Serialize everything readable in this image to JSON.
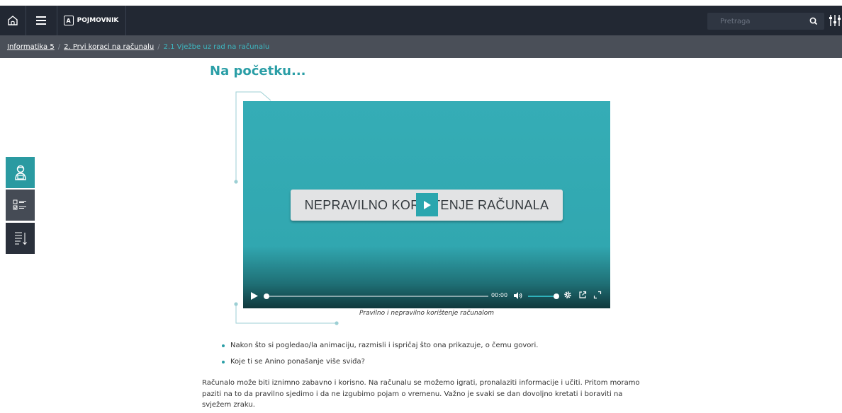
{
  "colors": {
    "topbar": "#222833",
    "breadcrumb_bar": "#4a4f58",
    "accent_teal": "#2a9ea6",
    "video_bg": "#31a7b0"
  },
  "header": {
    "home_icon": "home-icon",
    "menu_icon": "hamburger-menu-icon",
    "pojmovnik_badge": "A",
    "pojmovnik_label": "POJMOVNIK",
    "search_placeholder": "Pretraga",
    "search_icon": "search-icon",
    "settings_icon": "sliders-settings-icon"
  },
  "breadcrumb": {
    "items": [
      "Informatika 5",
      "2. Prvi koraci na računalu"
    ],
    "separator": "/",
    "current": "2.1 Vježbe uz rad na računalu"
  },
  "sidebar": {
    "buttons": [
      {
        "icon": "student-avatar-icon",
        "state": "active"
      },
      {
        "icon": "checklist-icon",
        "state": "default"
      },
      {
        "icon": "sort-list-icon",
        "state": "default"
      }
    ]
  },
  "main": {
    "title": "Na početku...",
    "video": {
      "title_card": "NEPRAVILNO KORIŠTENJE RAČUNALA",
      "time": "00:00",
      "progress": 0,
      "volume": 1.0,
      "caption": "Pravilno i nepravilno korištenje računalom"
    },
    "questions": [
      "Nakon što si pogledao/la animaciju, razmisli i ispričaj što ona prikazuje, o čemu govori.",
      "Koje ti se Anino ponašanje više sviđa?"
    ],
    "paragraph": "Računalo može biti iznimno zabavno i korisno. Na računalu se možemo igrati, pronalaziti informacije i učiti. Pritom moramo paziti na to da pravilno sjedimo i da ne izgubimo pojam o vremenu. Važno je svaki se dan dovoljno kretati i boraviti na svježem zraku."
  }
}
